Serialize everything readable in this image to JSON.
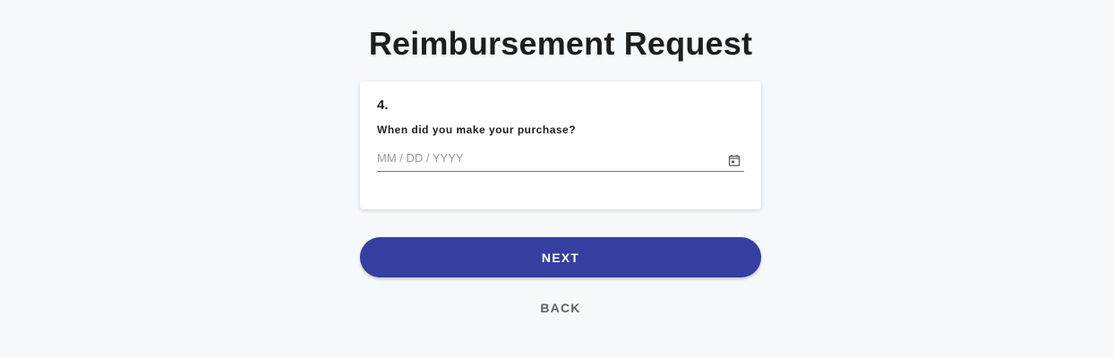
{
  "form": {
    "title": "Reimbursement Request",
    "question": {
      "number": "4.",
      "text": "When did you make your purchase?",
      "date_input": {
        "value": "",
        "placeholder": "MM / DD / YYYY",
        "icon": "calendar-icon"
      }
    },
    "next_label": "NEXT",
    "back_label": "BACK"
  },
  "colors": {
    "background": "#f6f9fc",
    "card": "#ffffff",
    "primary_button": "#353fa0",
    "title_text": "#1e1e1e",
    "back_text": "#5f6368"
  }
}
